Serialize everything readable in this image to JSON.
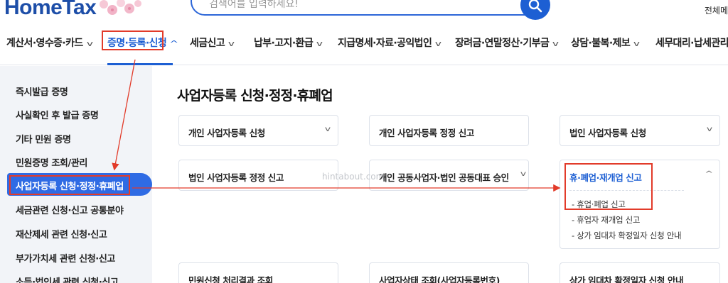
{
  "header": {
    "logo": "HomeTax",
    "search_placeholder": "검색어를 입력하세요!",
    "right_link": "전체메"
  },
  "nav": {
    "items": [
      {
        "label": "계산서·영수증·카드"
      },
      {
        "label": "증명·등록·신청"
      },
      {
        "label": "세금신고"
      },
      {
        "label": "납부·고지·환급"
      },
      {
        "label": "지급명세·자료·공익법인"
      },
      {
        "label": "장려금·연말정산·기부금"
      },
      {
        "label": "상담·불복·제보"
      },
      {
        "label": "세무대리·납세관리"
      }
    ],
    "active_index": 1
  },
  "sidebar": {
    "items": [
      {
        "label": "즉시발급 증명"
      },
      {
        "label": "사실확인 후 발급 증명"
      },
      {
        "label": "기타 민원 증명"
      },
      {
        "label": "민원증명 조회/관리"
      },
      {
        "label": "사업자등록 신청·정정·휴폐업"
      },
      {
        "label": "세금관련 신청·신고 공통분야"
      },
      {
        "label": "재산제세 관련 신청·신고"
      },
      {
        "label": "부가가치세 관련 신청·신고"
      },
      {
        "label": "소득·법인세 관련 신청·신고"
      }
    ],
    "active_index": 4
  },
  "main": {
    "title": "사업자등록 신청·정정·휴폐업",
    "cards": [
      {
        "label": "개인 사업자등록 신청"
      },
      {
        "label": "개인 사업자등록 정정 신고"
      },
      {
        "label": "법인 사업자등록 신청"
      },
      {
        "label": "법인 사업자등록 정정 신고"
      },
      {
        "label": "개인 공동사업자·법인 공동대표 승인"
      },
      {
        "label": "휴·폐업·재개업 신고",
        "sub_items": [
          {
            "label": "휴업·폐업 신고"
          },
          {
            "label": "휴업자 재개업 신고"
          },
          {
            "label": "상가 임대차 확정일자 신청 안내"
          }
        ]
      },
      {
        "label": "민원신청 처리결과 조회"
      },
      {
        "label": "사업자상태 조회(사업자등록번호)"
      },
      {
        "label": "상가 임대차 확정일자 신청 안내"
      }
    ],
    "watermark": "hintabout.com"
  },
  "colors": {
    "brand_blue": "#1d5fd3",
    "sidebar_active": "#2f6be4",
    "annotation_red": "#e23b2a"
  },
  "icons": [
    "search-icon",
    "chevron-down-icon",
    "chevron-up-icon",
    "logo-flower-icon"
  ]
}
